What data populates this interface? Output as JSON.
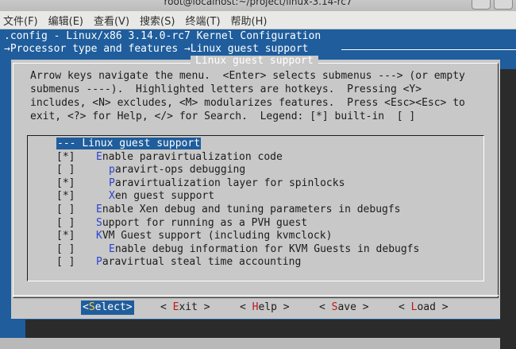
{
  "window": {
    "title": "root@localhost:~/project/linux-3.14-rc7"
  },
  "menubar": [
    {
      "label": "文件(F)"
    },
    {
      "label": "编辑(E)"
    },
    {
      "label": "查看(V)"
    },
    {
      "label": "搜索(S)"
    },
    {
      "label": "终端(T)"
    },
    {
      "label": "帮助(H)"
    }
  ],
  "terminal": {
    "header_line1": ".config - Linux/x86 3.14.0-rc7 Kernel Configuration",
    "header_line2": "→Processor type and features →Linux guest support"
  },
  "dialog": {
    "title": "Linux guest support",
    "help_lines": [
      "Arrow keys navigate the menu.  <Enter> selects submenus ---> (or empty",
      "submenus ----).  Highlighted letters are hotkeys.  Pressing <Y>",
      "includes, <N> excludes, <M> modularizes features.  Press <Esc><Esc> to",
      "exit, <?> for Help, </> for Search.  Legend: [*] built-in  [ ]"
    ],
    "items": [
      {
        "prefix": "--- ",
        "hotkey": "",
        "rest": "Linux guest support",
        "selected": true,
        "indent": 0,
        "bracket": ""
      },
      {
        "bracket": "[*]",
        "hotkey": "E",
        "rest": "nable paravirtualization code",
        "indent": 0
      },
      {
        "bracket": "[ ]",
        "hotkey": "p",
        "rest": "aravirt-ops debugging",
        "indent": 1
      },
      {
        "bracket": "[*]",
        "hotkey": "P",
        "rest": "aravirtualization layer for spinlocks",
        "indent": 1
      },
      {
        "bracket": "[*]",
        "hotkey": "X",
        "rest": "en guest support",
        "indent": 1
      },
      {
        "bracket": "[ ]",
        "hotkey": "E",
        "rest": "nable Xen debug and tuning parameters in debugfs",
        "indent": 0
      },
      {
        "bracket": "[ ]",
        "hotkey": "S",
        "rest": "upport for running as a PVH guest",
        "indent": 0
      },
      {
        "bracket": "[*]",
        "hotkey": "K",
        "rest": "VM Guest support (including kvmclock)",
        "indent": 0
      },
      {
        "bracket": "[ ]",
        "hotkey": "E",
        "rest": "nable debug information for KVM Guests in debugfs",
        "indent": 1
      },
      {
        "bracket": "[ ]",
        "hotkey": "P",
        "rest": "aravirtual steal time accounting",
        "indent": 0
      }
    ],
    "buttons": [
      {
        "pre": "<",
        "hotkey": "S",
        "post": "elect>",
        "active": true
      },
      {
        "pre": "< ",
        "hotkey": "E",
        "post": "xit >",
        "active": false
      },
      {
        "pre": "< ",
        "hotkey": "H",
        "post": "elp >",
        "active": false
      },
      {
        "pre": "< ",
        "hotkey": "S",
        "post": "ave >",
        "active": false
      },
      {
        "pre": "< ",
        "hotkey": "L",
        "post": "oad >",
        "active": false
      }
    ]
  }
}
